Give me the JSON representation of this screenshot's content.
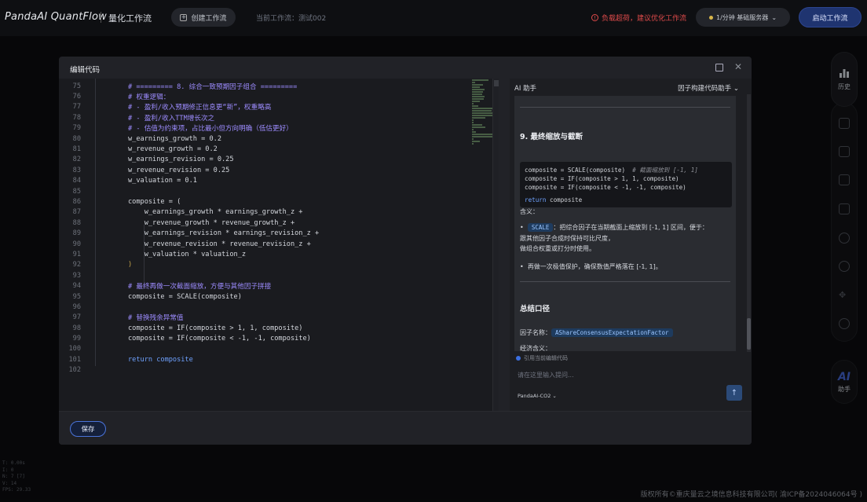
{
  "app": {
    "brand": "PandaAI QuantFlow",
    "section": "量化工作流",
    "create_button": "创建工作流",
    "current_flow": "当前工作流：测试002",
    "warning": "负载超荷，建议优化工作流",
    "server": "1/分钟 基础服务器",
    "start_button": "启动工作流",
    "history_label": "历史",
    "assistant_label": "助手",
    "ai_glyph": "AI",
    "footer": "版权所有©重庆量云之境信息科技有限公司( 渝ICP备2024046064号 )",
    "debug_lines": [
      "T: 0.00s",
      "I: 0",
      "N: 7 [7]",
      "V: 14",
      "FPS: 29.33"
    ]
  },
  "modal": {
    "title": "编辑代码",
    "save_button": "保存"
  },
  "code_lines": [
    {
      "n": "75",
      "t": "# ========= 8. 综合一致预期因子组合 =========",
      "cls": "c"
    },
    {
      "n": "76",
      "t": "# 权重逻辑：",
      "cls": "c"
    },
    {
      "n": "77",
      "t": "# - 盈利/收入预期修正信息更“新”，权重略高",
      "cls": "c"
    },
    {
      "n": "78",
      "t": "# - 盈利/收入TTM增长次之",
      "cls": "c"
    },
    {
      "n": "79",
      "t": "# - 估值为约束项，占比最小但方向明确（低估更好）",
      "cls": "c"
    },
    {
      "n": "80",
      "t": "w_earnings_growth = 0.2",
      "cls": ""
    },
    {
      "n": "81",
      "t": "w_revenue_growth = 0.2",
      "cls": ""
    },
    {
      "n": "82",
      "t": "w_earnings_revision = 0.25",
      "cls": ""
    },
    {
      "n": "83",
      "t": "w_revenue_revision = 0.25",
      "cls": ""
    },
    {
      "n": "84",
      "t": "w_valuation = 0.1",
      "cls": ""
    },
    {
      "n": "85",
      "t": "",
      "cls": ""
    },
    {
      "n": "86",
      "t": "composite = (",
      "cls": ""
    },
    {
      "n": "87",
      "t": "    w_earnings_growth * earnings_growth_z +",
      "cls": ""
    },
    {
      "n": "88",
      "t": "    w_revenue_growth * revenue_growth_z +",
      "cls": ""
    },
    {
      "n": "89",
      "t": "    w_earnings_revision * earnings_revision_z +",
      "cls": ""
    },
    {
      "n": "90",
      "t": "    w_revenue_revision * revenue_revision_z +",
      "cls": ""
    },
    {
      "n": "91",
      "t": "    w_valuation * valuation_z",
      "cls": ""
    },
    {
      "n": "92",
      "t": ")",
      "cls": "c2"
    },
    {
      "n": "93",
      "t": "",
      "cls": ""
    },
    {
      "n": "94",
      "t": "# 最终再做一次截面缩放，方便与其他因子拼接",
      "cls": "c"
    },
    {
      "n": "95",
      "t": "composite = SCALE(composite)",
      "cls": ""
    },
    {
      "n": "96",
      "t": "",
      "cls": ""
    },
    {
      "n": "97",
      "t": "# 替换残余异常值",
      "cls": "c"
    },
    {
      "n": "98",
      "t": "composite = IF(composite > 1, 1, composite)",
      "cls": ""
    },
    {
      "n": "99",
      "t": "composite = IF(composite < -1, -1, composite)",
      "cls": ""
    },
    {
      "n": "100",
      "t": "",
      "cls": ""
    },
    {
      "n": "101",
      "t": "return composite",
      "cls": "k"
    },
    {
      "n": "102",
      "t": "",
      "cls": ""
    }
  ],
  "assistant": {
    "title": "AI 助手",
    "mode": "因子构建代码助手",
    "section9": "9. 最终缩放与截断",
    "code": {
      "l1a": "composite = SCALE(composite)  ",
      "l1b": "# 截面缩放到 [-1, 1]",
      "l2": "composite = IF(composite > 1, 1, composite)",
      "l3": "composite = IF(composite < -1, -1, composite)",
      "l5a": "return",
      "l5b": " composite"
    },
    "meaning": "含义：",
    "bullet1_chip": "SCALE",
    "bullet1_text": "：把综合因子在当期截面上缩放到 [-1, 1] 区间，便于：",
    "bullet1_l2": "跟其他因子合成时保持可比尺度，",
    "bullet1_l3": "做组合权重或打分时使用。",
    "bullet2": "再做一次极值保护，确保数值严格落在 [-1, 1]。",
    "summary": "总结口径",
    "factor_name_label": "因子名称：",
    "factor_name": "AShareConsensusExpectationFactor",
    "econ_label": "经济含义：",
    "ref_code": "引用当前编辑代码",
    "input_placeholder": "请在这里输入提问...",
    "model": "PandaAI-CO2",
    "send_glyph": "↑"
  }
}
